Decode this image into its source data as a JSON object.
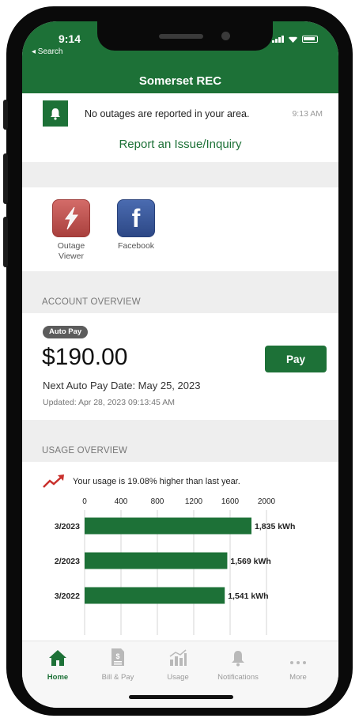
{
  "status_bar": {
    "time": "9:14",
    "back_label": "◂ Search"
  },
  "header": {
    "title": "Somerset REC"
  },
  "alert": {
    "icon": "bell-icon",
    "message": "No outages are reported in your area.",
    "time": "9:13 AM"
  },
  "report_link": "Report an Issue/Inquiry",
  "quick_links": [
    {
      "icon": "lightning-icon",
      "label_line1": "Outage",
      "label_line2": "Viewer",
      "color": "#c0524f"
    },
    {
      "icon": "facebook-icon",
      "label_line1": "Facebook",
      "label_line2": "",
      "color": "#3b5998"
    }
  ],
  "account": {
    "section_label": "ACCOUNT OVERVIEW",
    "badge": "Auto Pay",
    "amount": "$190.00",
    "next_date": "Next Auto Pay Date: May 25, 2023",
    "updated": "Updated: Apr 28, 2023 09:13:45 AM",
    "pay_label": "Pay"
  },
  "usage": {
    "section_label": "USAGE OVERVIEW",
    "trend_icon": "trend-up-icon",
    "summary": "Your usage is 19.08% higher than last year."
  },
  "chart_data": {
    "type": "bar",
    "orientation": "horizontal",
    "categories": [
      "3/2023",
      "2/2023",
      "3/2022"
    ],
    "values": [
      1835,
      1569,
      1541
    ],
    "value_labels": [
      "1,835 kWh",
      "1,569 kWh",
      "1,541 kWh"
    ],
    "unit": "kWh",
    "xlim": [
      0,
      2000
    ],
    "ticks": [
      "0",
      "400",
      "800",
      "1200",
      "1600",
      "2000"
    ],
    "tick_values": [
      0,
      400,
      800,
      1200,
      1600,
      2000
    ],
    "grid": true,
    "bar_color": "#1d7137"
  },
  "bottom_nav": [
    {
      "icon": "home-icon",
      "label": "Home",
      "active": true
    },
    {
      "icon": "bill-icon",
      "label": "Bill & Pay",
      "active": false
    },
    {
      "icon": "usage-chart-icon",
      "label": "Usage",
      "active": false
    },
    {
      "icon": "bell-icon",
      "label": "Notifications",
      "active": false
    },
    {
      "icon": "more-icon",
      "label": "More",
      "active": false
    }
  ],
  "colors": {
    "brand_green": "#1d7137",
    "trend_red": "#c9302c"
  }
}
